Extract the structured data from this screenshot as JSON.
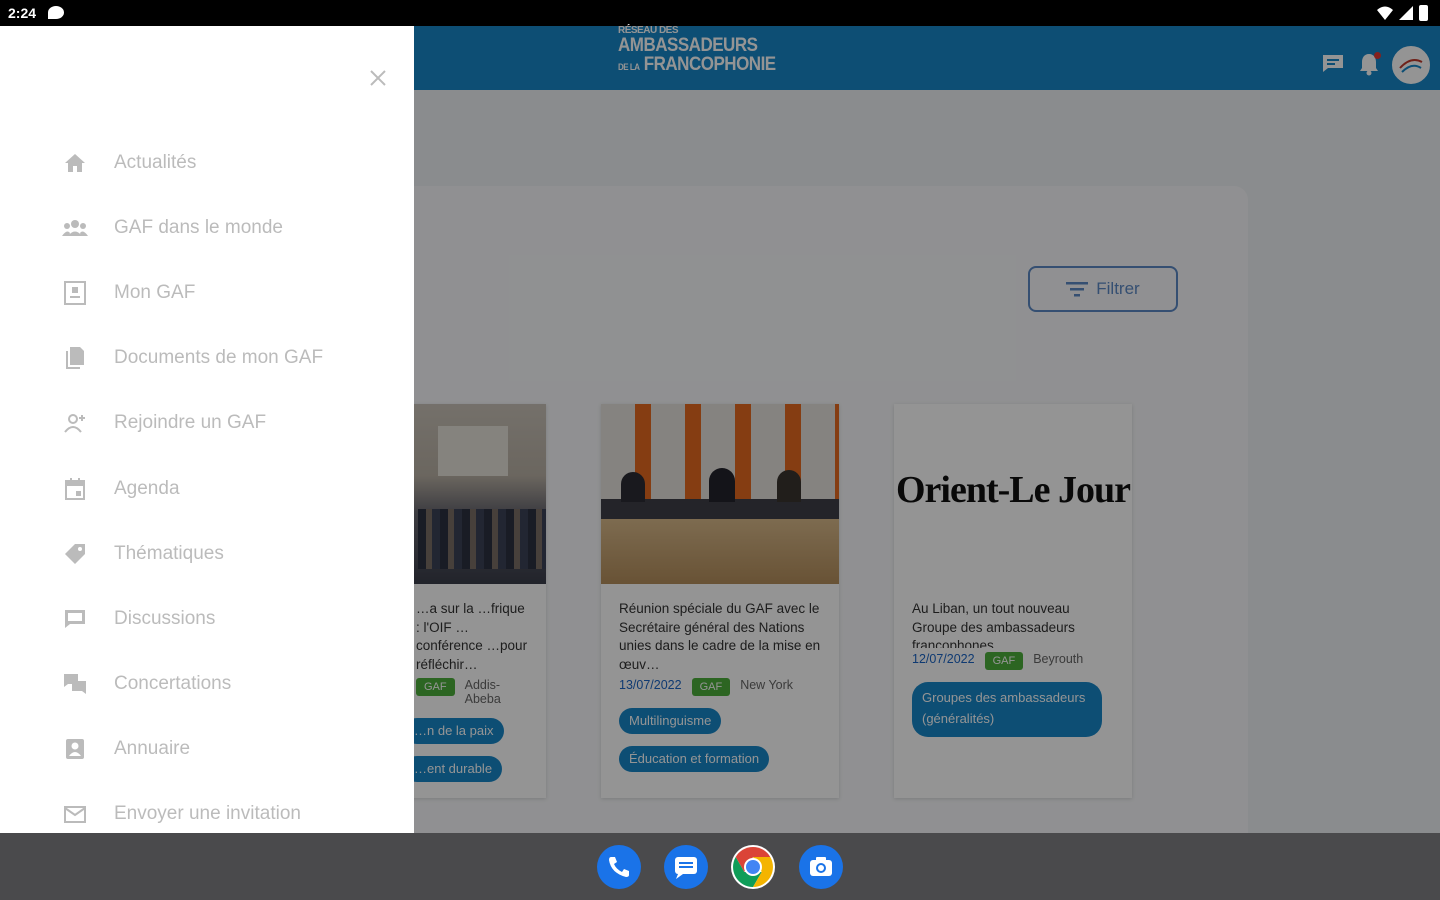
{
  "statusbar": {
    "time": "2:24"
  },
  "header": {
    "logo_line1": "RÉSEAU DES",
    "logo_line2": "AMBASSADEURS",
    "logo_line3_prefix": "DE LA",
    "logo_line3": "FRANCOPHONIE",
    "icons": [
      "message-icon",
      "bell-icon",
      "avatar"
    ],
    "colors": {
      "appbar": "#1787c9",
      "notification_dot": "#e53935"
    }
  },
  "drawer": {
    "items": [
      {
        "label": "Actualités",
        "icon": "home-icon"
      },
      {
        "label": "GAF dans le monde",
        "icon": "group-icon"
      },
      {
        "label": "Mon GAF",
        "icon": "badge-icon"
      },
      {
        "label": "Documents de mon GAF",
        "icon": "document-icon"
      },
      {
        "label": "Rejoindre un GAF",
        "icon": "join-person-icon"
      },
      {
        "label": "Agenda",
        "icon": "calendar-icon"
      },
      {
        "label": "Thématiques",
        "icon": "tag-icon"
      },
      {
        "label": "Discussions",
        "icon": "chat-icon"
      },
      {
        "label": "Concertations",
        "icon": "forum-icon"
      },
      {
        "label": "Annuaire",
        "icon": "contact-icon"
      },
      {
        "label": "Envoyer une invitation",
        "icon": "mail-icon"
      }
    ]
  },
  "main": {
    "filter_label": "Filtrer",
    "cards": [
      {
        "title": "…a sur la …frique : l'OIF …conférence …pour réfléchir…",
        "date": "",
        "badge": "GAF",
        "place": "Addis-Abeba",
        "tags": [
          "…n de la paix",
          "…ent durable"
        ]
      },
      {
        "title": "Réunion spéciale du GAF avec le Secrétaire général des Nations unies dans le cadre de la mise en œuv…",
        "date": "13/07/2022",
        "badge": "GAF",
        "place": "New York",
        "tags": [
          "Multilinguisme",
          "Éducation et formation"
        ]
      },
      {
        "title": "Au Liban, un tout nouveau Groupe des ambassadeurs francophones",
        "date": "12/07/2022",
        "badge": "GAF",
        "place": "Beyrouth",
        "image_text": "Orient-Le Jour",
        "tags": [
          "Groupes des ambassadeurs (généralités)"
        ]
      }
    ],
    "colors": {
      "tag": "#1787c9",
      "badge": "#4caf3b",
      "filter_border": "#5c88c4",
      "date": "#1a64c4"
    }
  },
  "dock": [
    "phone-icon",
    "messages-icon",
    "chrome-icon",
    "camera-icon"
  ]
}
